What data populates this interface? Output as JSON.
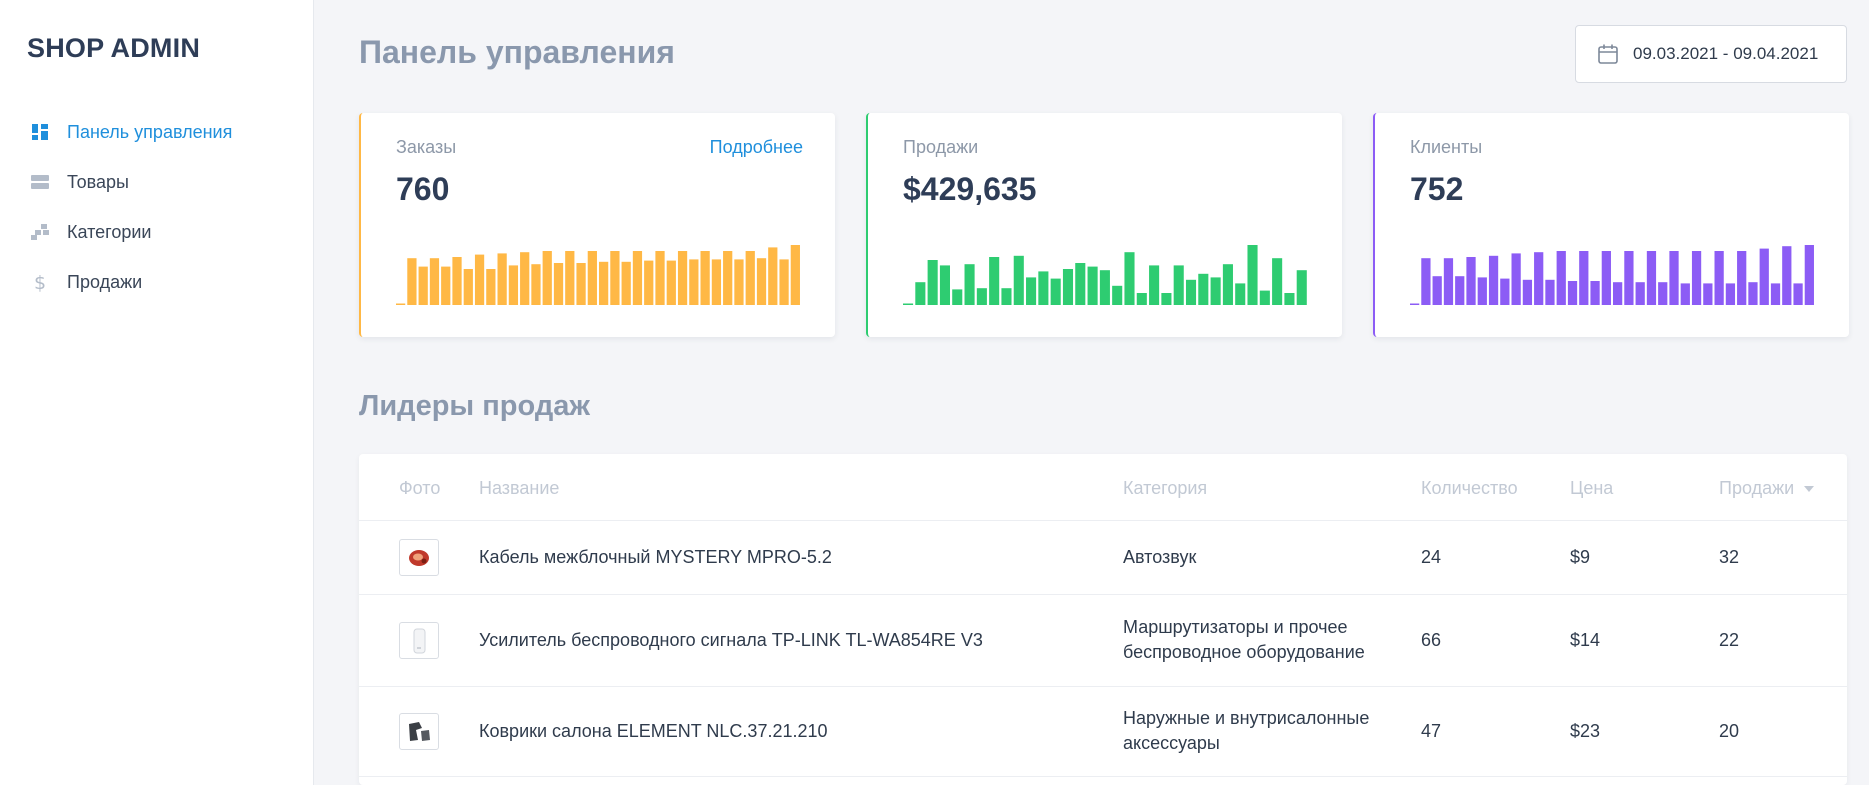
{
  "brand": "SHOP ADMIN",
  "sidebar": {
    "items": [
      {
        "label": "Панель управления",
        "icon": "dashboard-icon",
        "active": true
      },
      {
        "label": "Товары",
        "icon": "products-icon",
        "active": false
      },
      {
        "label": "Категории",
        "icon": "categories-icon",
        "active": false
      },
      {
        "label": "Продажи",
        "icon": "dollar-icon",
        "active": false
      }
    ]
  },
  "header": {
    "title": "Панель управления",
    "date_range": "09.03.2021 - 09.04.2021"
  },
  "colors": {
    "orders": "#ffb845",
    "sales": "#2ecc71",
    "clients": "#8c5cf5",
    "accent": "#1f8fdc"
  },
  "cards": [
    {
      "key": "orders",
      "label": "Заказы",
      "link": "Подробнее",
      "value": "760",
      "bars": [
        2,
        78,
        64,
        78,
        64,
        80,
        60,
        84,
        60,
        86,
        66,
        88,
        68,
        90,
        70,
        90,
        70,
        90,
        72,
        90,
        72,
        90,
        74,
        90,
        74,
        90,
        76,
        90,
        76,
        90,
        76,
        90,
        78,
        96,
        76,
        100
      ]
    },
    {
      "key": "sales",
      "label": "Продажи",
      "value": "$429,635",
      "bars": [
        2,
        38,
        75,
        66,
        26,
        68,
        28,
        80,
        28,
        82,
        46,
        56,
        44,
        60,
        70,
        64,
        58,
        32,
        88,
        20,
        66,
        20,
        66,
        42,
        52,
        46,
        68,
        36,
        100,
        24,
        78,
        20,
        58
      ]
    },
    {
      "key": "clients",
      "label": "Клиенты",
      "value": "752",
      "bars": [
        2,
        78,
        48,
        78,
        48,
        80,
        46,
        82,
        44,
        86,
        42,
        88,
        42,
        90,
        40,
        90,
        40,
        90,
        38,
        90,
        38,
        90,
        38,
        90,
        36,
        90,
        36,
        90,
        36,
        90,
        38,
        94,
        36,
        98,
        36,
        100
      ]
    }
  ],
  "top_products": {
    "title": "Лидеры продаж",
    "columns": [
      "Фото",
      "Название",
      "Категория",
      "Количество",
      "Цена",
      "Продажи"
    ],
    "rows": [
      {
        "name": "Кабель межблочный MYSTERY MPRO-5.2",
        "category": "Автозвук",
        "qty": "24",
        "price": "$9",
        "sales": "32",
        "thumb": "cable-icon"
      },
      {
        "name": "Усилитель беспроводного сигнала TP-LINK TL-WA854RE V3",
        "category": "Маршрутизаторы и прочее беспроводное оборудование",
        "qty": "66",
        "price": "$14",
        "sales": "22",
        "thumb": "wifi-extender-icon"
      },
      {
        "name": "Коврики салона ELEMENT NLC.37.21.210",
        "category": "Наружные и внутрисалонные аксессуары",
        "qty": "47",
        "price": "$23",
        "sales": "20",
        "thumb": "car-mats-icon"
      }
    ]
  }
}
